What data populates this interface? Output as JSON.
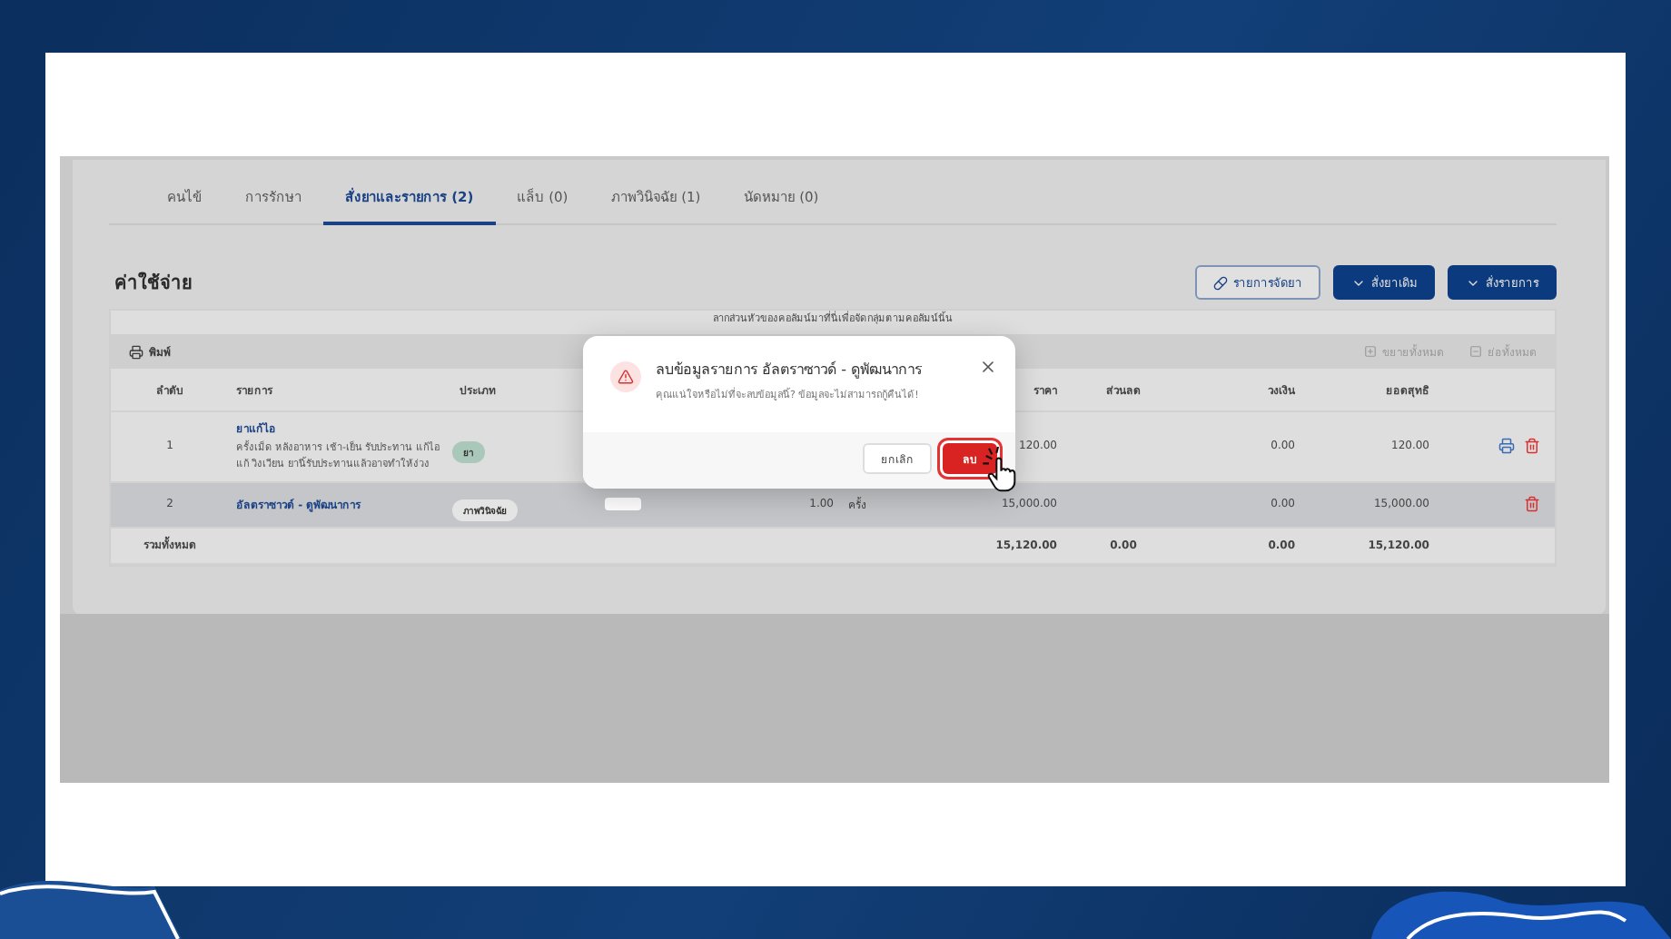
{
  "tabs": [
    {
      "label": "คนไข้",
      "selected": false
    },
    {
      "label": "การรักษา",
      "selected": false
    },
    {
      "label": "สั่งยาและรายการ (2)",
      "selected": true
    },
    {
      "label": "แล็บ (0)",
      "selected": false
    },
    {
      "label": "ภาพวินิจฉัย (1)",
      "selected": false
    },
    {
      "label": "นัดหมาย (0)",
      "selected": false
    }
  ],
  "section_title": "ค่าใช้จ่าย",
  "actions": [
    {
      "label": "รายการจัดยา",
      "kind": "outline"
    },
    {
      "label": "สั่งยาเดิม",
      "kind": "primary"
    },
    {
      "label": "สั่งรายการ",
      "kind": "primary"
    }
  ],
  "grid": {
    "group_hint": "ลากส่วนหัวของคอลัมน์มาที่นี่เพื่อจัดกลุ่มตามคอลัมน์นั้น",
    "print": "พิมพ์",
    "expand_all": "ขยายทั้งหมด",
    "collapse_all": "ย่อทั้งหมด",
    "headers": {
      "no": "ลำดับ",
      "item": "รายการ",
      "type": "ประเภท",
      "price": "ราคา",
      "discount": "ส่วนลด",
      "limit": "วงเงิน",
      "net": "ยอดสุทธิ"
    },
    "rows": [
      {
        "no": "1",
        "name": "ยาแก้ไอ",
        "detail": "ครั้งเม็ด หลังอาหาร เช้า-เย็น รับประทาน แก้ไอ แก้ วิงเวียน ยานี้รับประทานแล้วอาจทำให้ง่วง",
        "tag": {
          "label": "ยา",
          "color": "#a9c8b9"
        },
        "field": false,
        "price": "120.00",
        "limit": "0.00",
        "net": "120.00",
        "actions": [
          {
            "kind": "print"
          },
          {
            "kind": "delete"
          }
        ],
        "selected": false
      },
      {
        "no": "2",
        "name": "อัลตราซาวด์ - ดูพัฒนาการ",
        "tag": {
          "label": "ภาพวินิจฉัย",
          "color": "#e4e4e4"
        },
        "field": true,
        "quantity": "1.00",
        "unit": "ครั้ง",
        "price": "15,000.00",
        "limit": "0.00",
        "net": "15,000.00",
        "actions": [
          {
            "kind": "delete"
          }
        ],
        "selected": true
      }
    ],
    "totals": {
      "label": "รวมทั้งหมด",
      "price": "15,120.00",
      "discount": "0.00",
      "limit": "0.00",
      "net": "15,120.00"
    }
  },
  "dialog": {
    "title": "ลบข้อมูลรายการ อัลตราซาวด์ - ดูพัฒนาการ",
    "message": "คุณแน่ใจหรือไม่ที่จะลบข้อมูลนี้? ข้อมูลจะไม่สามารถกู้คืนได้!",
    "cancel": "ยกเลิก",
    "confirm": "ลบ"
  }
}
